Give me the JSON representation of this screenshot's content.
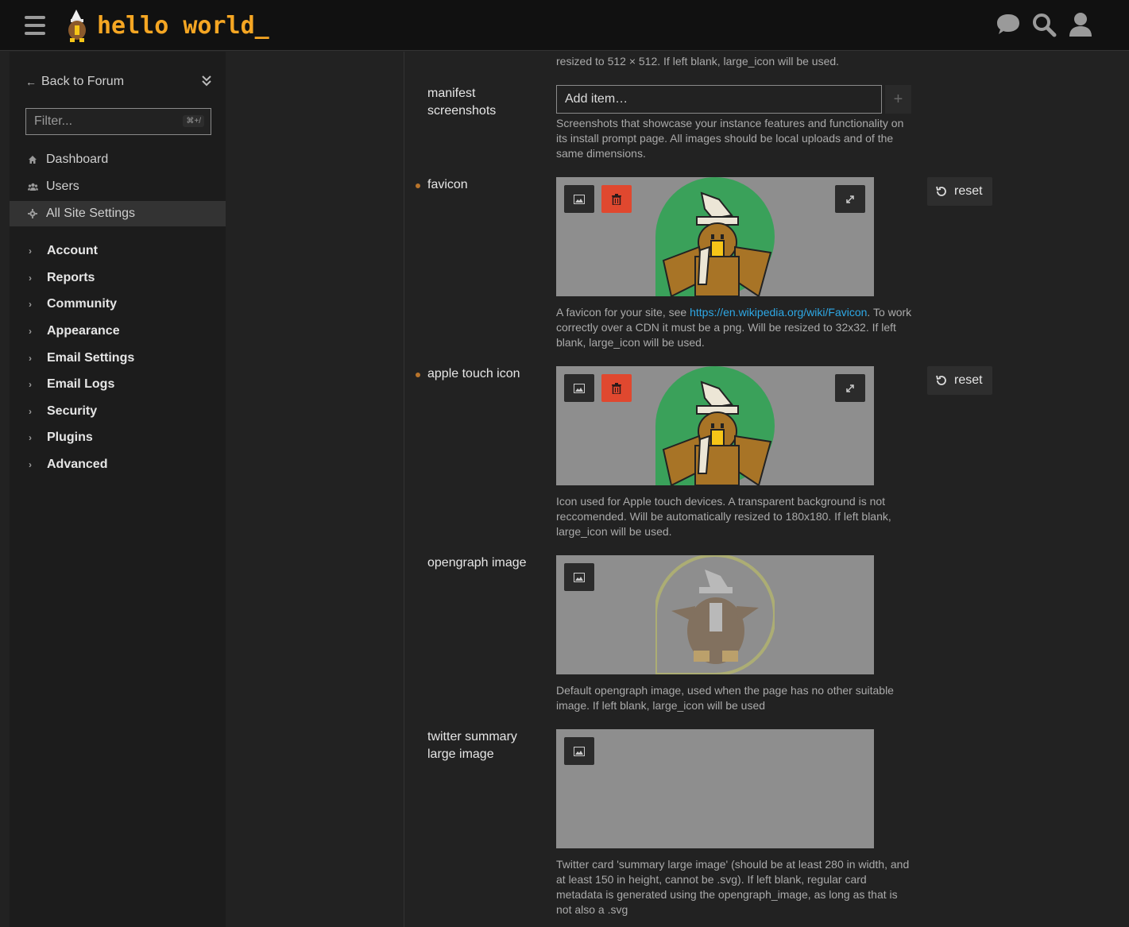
{
  "header": {
    "logo_text": "hello world_",
    "icons": [
      "hamburger-icon",
      "chat-icon",
      "search-icon",
      "user-icon"
    ]
  },
  "sidebar": {
    "back_label": "Back to Forum",
    "filter_placeholder": "Filter...",
    "filter_shortcut": "⌘+/",
    "nav": [
      {
        "label": "Dashboard",
        "icon": "home-icon"
      },
      {
        "label": "Users",
        "icon": "users-icon"
      },
      {
        "label": "All Site Settings",
        "icon": "gear-icon"
      }
    ],
    "categories": [
      "Account",
      "Reports",
      "Community",
      "Appearance",
      "Email Settings",
      "Email Logs",
      "Security",
      "Plugins",
      "Advanced"
    ]
  },
  "settings": {
    "top_desc_tail": "resized to 512 × 512. If left blank, large_icon will be used.",
    "manifest_screenshots": {
      "label": "manifest screenshots",
      "input_placeholder": "Add item…",
      "description": "Screenshots that showcase your instance features and functionality on its install prompt page. All images should be local uploads and of the same dimensions."
    },
    "favicon": {
      "label": "favicon",
      "reset_label": "reset",
      "desc_before": "A favicon for your site, see ",
      "desc_link": "https://en.wikipedia.org/wiki/Favicon",
      "desc_after": ". To work correctly over a CDN it must be a png. Will be resized to 32x32. If left blank, large_icon will be used."
    },
    "apple_touch_icon": {
      "label": "apple touch icon",
      "reset_label": "reset",
      "description": "Icon used for Apple touch devices. A transparent background is not reccomended. Will be automatically resized to 180x180. If left blank, large_icon will be used."
    },
    "opengraph_image": {
      "label": "opengraph image",
      "description": "Default opengraph image, used when the page has no other suitable image. If left blank, large_icon will be used"
    },
    "twitter_summary_large_image": {
      "label": "twitter summary large image",
      "description": "Twitter card 'summary large image' (should be at least 280 in width, and at least 150 in height, cannot be .svg). If left blank, regular card metadata is generated using the opengraph_image, as long as that is not also a .svg"
    }
  },
  "colors": {
    "accent": "#f5a623",
    "danger": "#e0482f",
    "link": "#2ea8e5",
    "modified_dot": "#b8742b"
  }
}
